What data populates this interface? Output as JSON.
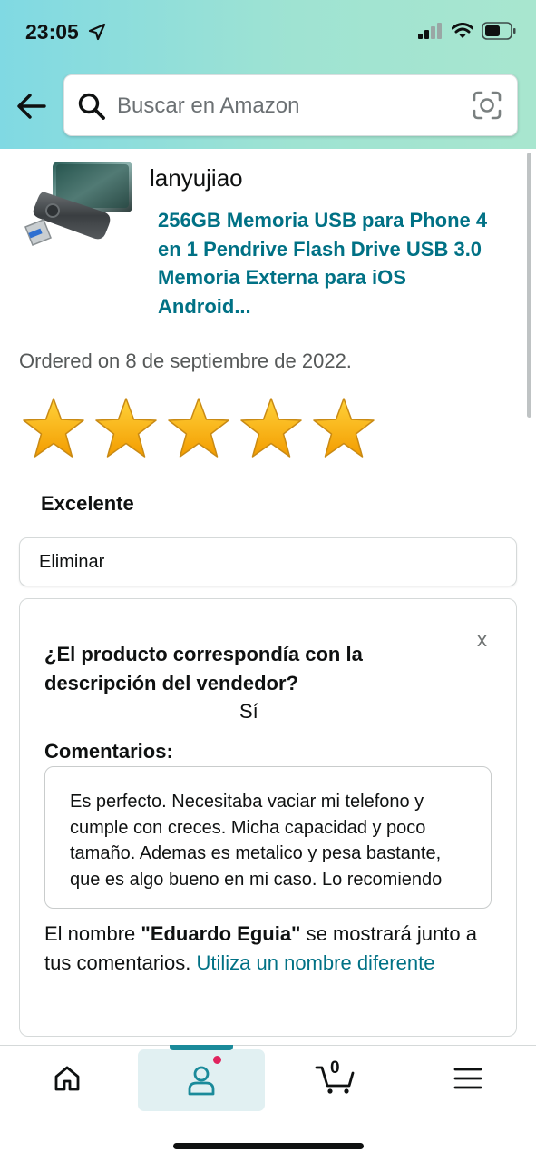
{
  "status_bar": {
    "time": "23:05",
    "icons": [
      "location-arrow-icon",
      "cellular-signal-icon",
      "wifi-icon",
      "battery-icon"
    ]
  },
  "header": {
    "back_icon": "back-arrow-icon",
    "search": {
      "placeholder": "Buscar en Amazon",
      "value": "",
      "left_icon": "search-icon",
      "right_icon": "camera-scan-icon"
    }
  },
  "product": {
    "seller": "lanyujiao",
    "title": "256GB Memoria USB para Phone 4 en 1 Pendrive Flash Drive USB 3.0 Memoria Externa para iOS Android...",
    "ordered": "Ordered on 8 de septiembre de 2022."
  },
  "rating": {
    "stars": 5,
    "max_stars": 5,
    "label": "Excelente",
    "star_color": "#f7b500"
  },
  "eliminar_label": "Eliminar",
  "feedback_card": {
    "close_label": "x",
    "question": "¿El producto correspondía con la descripción del vendedor?",
    "answer": "Sí",
    "comments_label": "Comentarios:",
    "comment_text": "Es perfecto. Necesitaba vaciar mi telefono y cumple con creces. Micha capacidad y poco tamaño. Ademas es metalico y pesa bastante, que es algo bueno en mi caso. Lo recomiendo",
    "name_note_prefix": "El nombre ",
    "name_note_name": "\"Eduardo Eguia\"",
    "name_note_suffix": " se mostrará junto a tus comentarios. ",
    "name_note_link": "Utiliza un nombre diferente"
  },
  "bottom_nav": {
    "items": [
      "home-icon",
      "account-icon",
      "cart-icon",
      "menu-icon"
    ],
    "active": "account",
    "cart_count": "0"
  },
  "colors": {
    "link": "#007185",
    "header_gradient_start": "#80d9e3",
    "header_gradient_end": "#a8e6cf",
    "notification_dot": "#e0245e"
  }
}
